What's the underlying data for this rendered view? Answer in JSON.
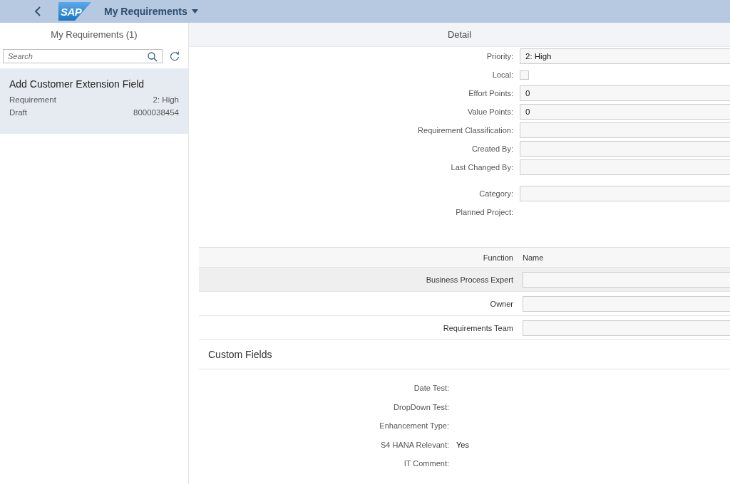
{
  "header": {
    "logo": "SAP",
    "title": "My Requirements"
  },
  "master": {
    "title": "My Requirements (1)",
    "search": {
      "placeholder": "Search"
    },
    "items": [
      {
        "title": "Add Customer Extension Field",
        "type": "Requirement",
        "priority": "2: High",
        "status": "Draft",
        "number": "8000038454",
        "selected": true
      }
    ]
  },
  "detail": {
    "title": "Detail",
    "fields": [
      {
        "label": "Priority:",
        "kind": "input",
        "value": "2: High"
      },
      {
        "label": "Local:",
        "kind": "checkbox",
        "checked": false
      },
      {
        "label": "Effort Points:",
        "kind": "input",
        "value": "0"
      },
      {
        "label": "Value Points:",
        "kind": "input",
        "value": "0"
      },
      {
        "label": "Requirement Classification:",
        "kind": "input"
      },
      {
        "label": "Created By:",
        "kind": "input"
      },
      {
        "label": "Last Changed By:",
        "kind": "input"
      },
      {
        "label": "Category:",
        "kind": "input"
      },
      {
        "label": "Planned Project:",
        "kind": "text"
      }
    ],
    "team": {
      "columns": [
        "Function",
        "Name"
      ],
      "rows": [
        {
          "function": "Business Process Expert",
          "selected": true
        },
        {
          "function": "Owner",
          "selected": false
        },
        {
          "function": "Requirements Team",
          "selected": false
        }
      ]
    },
    "custom": {
      "title": "Custom Fields",
      "fields": [
        {
          "label": "Date Test:"
        },
        {
          "label": "DropDown Test:"
        },
        {
          "label": "Enhancement Type:"
        },
        {
          "label": "S4 HANA Relevant:",
          "value": "Yes"
        },
        {
          "label": "IT Comment:"
        }
      ]
    }
  }
}
